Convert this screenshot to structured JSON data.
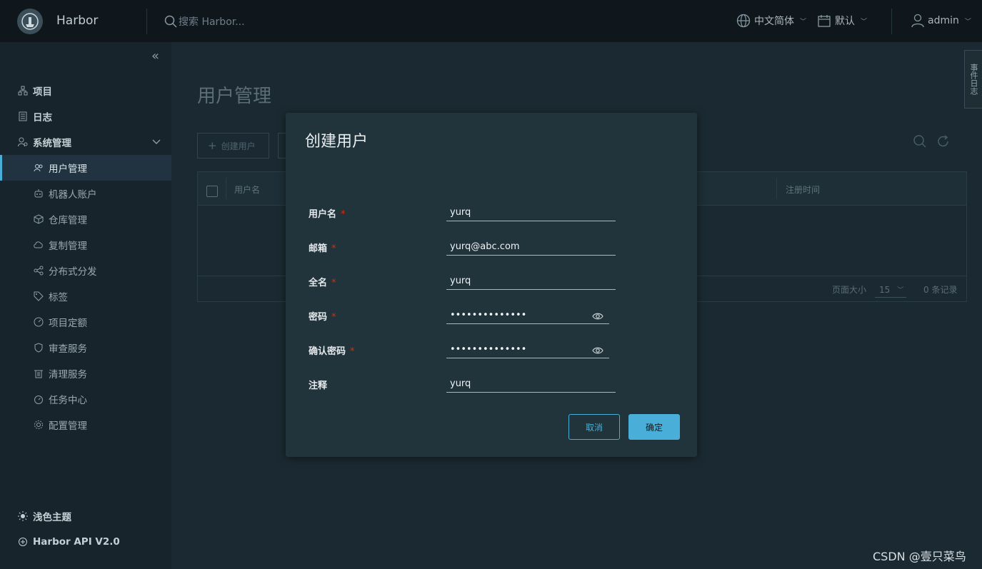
{
  "header": {
    "brand": "Harbor",
    "search_placeholder": "搜索 Harbor...",
    "language": "中文简体",
    "datetime_format": "默认",
    "user": "admin"
  },
  "sidebar": {
    "items": [
      {
        "label": "项目",
        "icon": "projects-icon"
      },
      {
        "label": "日志",
        "icon": "logs-icon"
      },
      {
        "label": "系统管理",
        "icon": "admin-icon"
      }
    ],
    "sub_items": [
      {
        "label": "用户管理",
        "icon": "users-icon"
      },
      {
        "label": "机器人账户",
        "icon": "robot-icon"
      },
      {
        "label": "仓库管理",
        "icon": "registry-icon"
      },
      {
        "label": "复制管理",
        "icon": "replication-icon"
      },
      {
        "label": "分布式分发",
        "icon": "distribution-icon"
      },
      {
        "label": "标签",
        "icon": "tag-icon"
      },
      {
        "label": "项目定额",
        "icon": "quota-icon"
      },
      {
        "label": "审查服务",
        "icon": "shield-icon"
      },
      {
        "label": "清理服务",
        "icon": "trash-icon"
      },
      {
        "label": "任务中心",
        "icon": "tasks-icon"
      },
      {
        "label": "配置管理",
        "icon": "gear-icon"
      }
    ],
    "theme": "浅色主题",
    "api": "Harbor API V2.0"
  },
  "main": {
    "title": "用户管理",
    "create_button": "创建用户",
    "columns": [
      "用户名",
      "注册时间"
    ],
    "page_size_label": "页面大小",
    "page_size": "15",
    "record_count": "0 条记录"
  },
  "modal": {
    "title": "创建用户",
    "fields": [
      {
        "label": "用户名",
        "required": "*",
        "value": "yurq"
      },
      {
        "label": "邮箱",
        "required": "*",
        "value": "yurq@abc.com"
      },
      {
        "label": "全名",
        "required": "*",
        "value": "yurq"
      },
      {
        "label": "密码",
        "required": "*",
        "value": "••••••••••••••"
      },
      {
        "label": "确认密码",
        "required": "*",
        "value": "••••••••••••••"
      },
      {
        "label": "注释",
        "required": "",
        "value": "yurq"
      }
    ],
    "cancel": "取消",
    "ok": "确定"
  },
  "side_tab": "事件日志",
  "watermark": "CSDN @壹只菜鸟",
  "colors": {
    "accent": "#49afd9",
    "required": "#e62700"
  }
}
